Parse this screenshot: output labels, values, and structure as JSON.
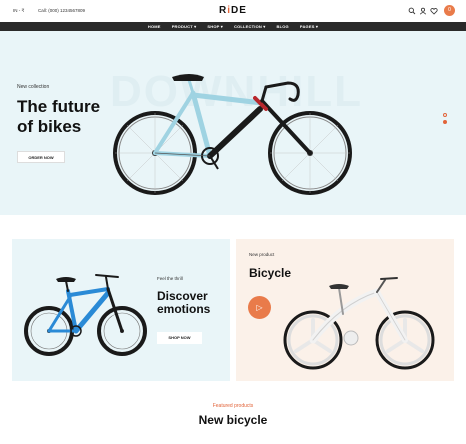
{
  "topbar": {
    "language": "IN - ₹",
    "call": "Call: (000) 1234567809",
    "logo_prefix": "R",
    "logo_accent": "i",
    "logo_suffix": "DE",
    "cart_count": "0"
  },
  "nav": {
    "items": [
      {
        "label": "HOME"
      },
      {
        "label": "PRODUCT ▾"
      },
      {
        "label": "SHOP ▾"
      },
      {
        "label": "COLLECTION ▾"
      },
      {
        "label": "BLOG"
      },
      {
        "label": "PAGES ▾"
      }
    ]
  },
  "hero": {
    "watermark": "DOWNHILL",
    "subtitle": "New collection",
    "title_line1": "The future",
    "title_line2": "of bikes",
    "button": "ORDER NOW",
    "slide_count": 2,
    "active_slide": 1
  },
  "promo_left": {
    "subtitle": "Feel the thrill",
    "title_line1": "Discover",
    "title_line2": "emotions",
    "button": "SHOP NOW"
  },
  "promo_right": {
    "subtitle": "New product",
    "title": "Bicycle"
  },
  "featured": {
    "subtitle": "Featured products",
    "title": "New bicycle"
  },
  "colors": {
    "accent": "#e2643a",
    "hero_bg": "#e9f5f8",
    "nav_bg": "#2a2a2a",
    "card_right_bg": "#fbf1e9"
  },
  "icons": [
    "search-icon",
    "user-icon",
    "heart-icon",
    "cart-icon",
    "play-icon"
  ]
}
